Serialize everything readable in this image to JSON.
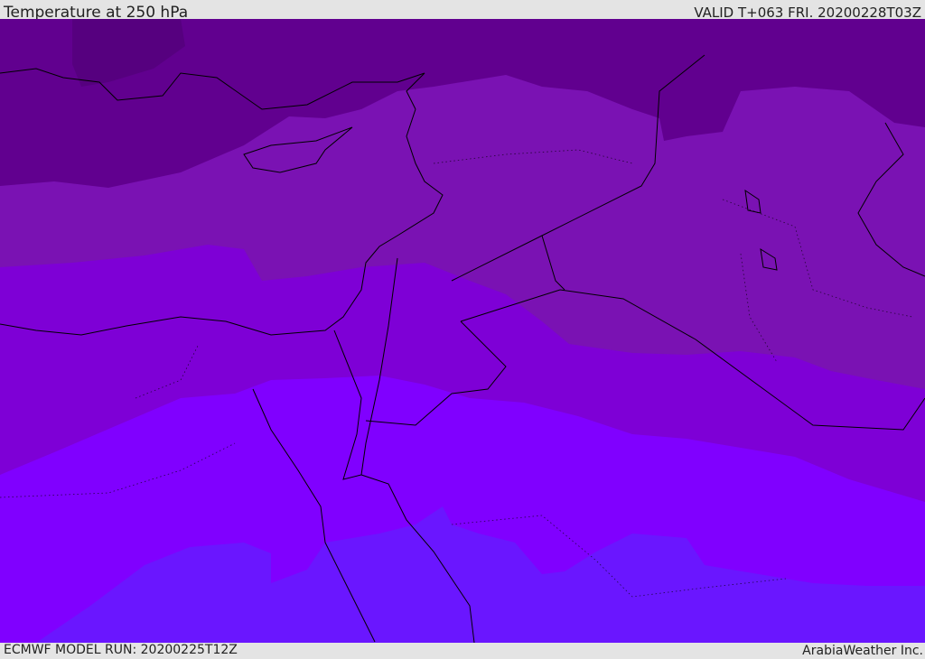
{
  "header": {
    "title": "Temperature at 250 hPa",
    "valid": "VALID T+063 FRI. 20200228T03Z"
  },
  "footer": {
    "model_run": "ECMWF MODEL RUN: 20200225T12Z",
    "credit": "ArabiaWeather Inc."
  },
  "map": {
    "field": "temperature",
    "level": "250 hPa",
    "band_colors": [
      "#56007f",
      "#61008f",
      "#7a12b3",
      "#7e00d6",
      "#8000ff",
      "#6a16ff"
    ],
    "coastline_color": "#000000"
  }
}
